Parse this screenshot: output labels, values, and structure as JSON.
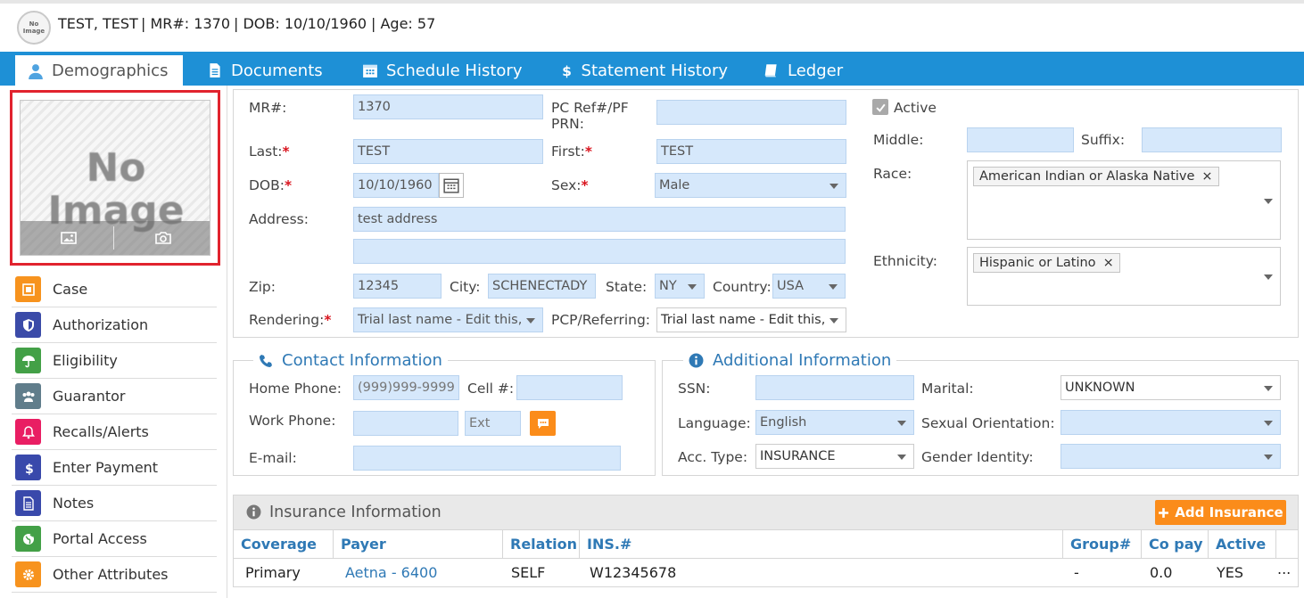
{
  "header": {
    "avatar_text": "No Image",
    "name": "TEST, TEST",
    "mr": "| MR#: 1370",
    "dob": "| DOB: 10/10/1960",
    "age": "| Age: 57"
  },
  "tabs": [
    {
      "label": "Demographics",
      "icon": "user-icon",
      "active": true
    },
    {
      "label": "Documents",
      "icon": "document-icon"
    },
    {
      "label": "Schedule History",
      "icon": "calendar-icon"
    },
    {
      "label": "Statement History",
      "icon": "dollar-icon"
    },
    {
      "label": "Ledger",
      "icon": "book-icon"
    }
  ],
  "photo": {
    "placeholder": "No Image"
  },
  "menu": [
    {
      "label": "Case",
      "icon": "case-icon",
      "color": "#f7931e"
    },
    {
      "label": "Authorization",
      "icon": "shield-icon",
      "color": "#3b4ba8"
    },
    {
      "label": "Eligibility",
      "icon": "umbrella-icon",
      "color": "#43a047"
    },
    {
      "label": "Guarantor",
      "icon": "group-icon",
      "color": "#607d8b"
    },
    {
      "label": "Recalls/Alerts",
      "icon": "bell-icon",
      "color": "#e91e63"
    },
    {
      "label": "Enter Payment",
      "icon": "dollar-icon",
      "color": "#3949ab"
    },
    {
      "label": "Notes",
      "icon": "notes-icon",
      "color": "#3949ab"
    },
    {
      "label": "Portal Access",
      "icon": "globe-icon",
      "color": "#43a047"
    },
    {
      "label": "Other Attributes",
      "icon": "gear-icon",
      "color": "#f7931e"
    }
  ],
  "demographics": {
    "mr_label": "MR#:",
    "mr_value": "1370",
    "pcref_label_1": "PC Ref#/PF",
    "pcref_label_2": "PRN:",
    "pcref_value": "",
    "last_label": "Last:",
    "last_value": "TEST",
    "first_label": "First:",
    "first_value": "TEST",
    "dob_label": "DOB:",
    "dob_value": "10/10/1960",
    "sex_label": "Sex:",
    "sex_value": "Male",
    "address_label": "Address:",
    "address1": "test address",
    "address2": "",
    "zip_label": "Zip:",
    "zip_value": "12345",
    "city_label": "City:",
    "city_value": "SCHENECTADY",
    "state_label": "State:",
    "state_value": "NY",
    "country_label": "Country:",
    "country_value": "USA",
    "rendering_label": "Rendering:",
    "rendering_value": "Trial last name - Edit this,",
    "pcp_label": "PCP/Referring:",
    "pcp_value": "Trial last name - Edit this,",
    "active_label": "Active",
    "middle_label": "Middle:",
    "middle_value": "",
    "suffix_label": "Suffix:",
    "suffix_value": "",
    "race_label": "Race:",
    "race_tag": "American Indian or Alaska Native",
    "ethnicity_label": "Ethnicity:",
    "ethnicity_tag": "Hispanic or Latino",
    "required_mark": "*",
    "remove_mark": "×"
  },
  "contact": {
    "title": "Contact Information",
    "home_label": "Home Phone:",
    "home_placeholder": "(999)999-9999",
    "cell_label": "Cell #:",
    "cell_value": "",
    "work_label": "Work Phone:",
    "work_value": "",
    "ext_placeholder": "Ext",
    "email_label": "E-mail:",
    "email_value": ""
  },
  "additional": {
    "title": "Additional Information",
    "ssn_label": "SSN:",
    "ssn_value": "",
    "marital_label": "Marital:",
    "marital_value": "UNKNOWN",
    "language_label": "Language:",
    "language_value": "English",
    "orientation_label": "Sexual Orientation:",
    "orientation_value": "",
    "acc_label": "Acc. Type:",
    "acc_value": "INSURANCE",
    "gender_label": "Gender Identity:",
    "gender_value": ""
  },
  "insurance": {
    "title": "Insurance Information",
    "add_button": "Add Insurance",
    "columns": [
      "Coverage",
      "Payer",
      "Relation",
      "INS.#",
      "Group#",
      "Co pay",
      "Active"
    ],
    "rows": [
      {
        "coverage": "Primary",
        "payer": "Aetna - 6400",
        "relation": "SELF",
        "ins": "W12345678",
        "group": "-",
        "copay": "0.0",
        "active": "YES",
        "more": "..."
      }
    ]
  },
  "colors": {
    "tab_blue": "#1e90d6",
    "accent_orange": "#fb8c1a",
    "highlight_red": "#e1232e",
    "link_blue": "#2f79b5"
  }
}
